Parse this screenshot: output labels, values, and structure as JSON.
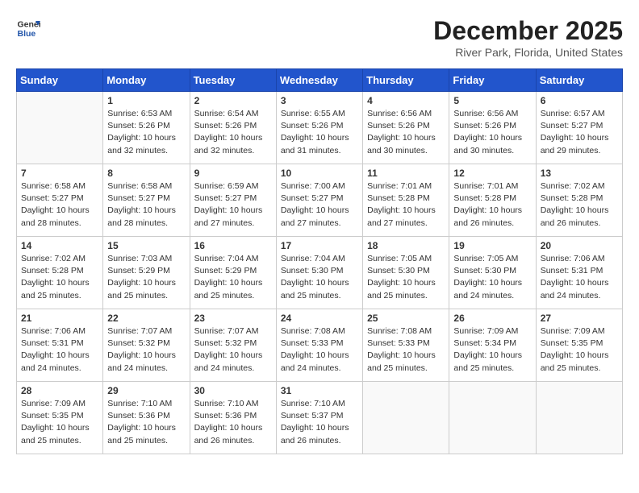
{
  "header": {
    "logo_line1": "General",
    "logo_line2": "Blue",
    "title": "December 2025",
    "subtitle": "River Park, Florida, United States"
  },
  "calendar": {
    "days_of_week": [
      "Sunday",
      "Monday",
      "Tuesday",
      "Wednesday",
      "Thursday",
      "Friday",
      "Saturday"
    ],
    "weeks": [
      [
        {
          "day": "",
          "info": ""
        },
        {
          "day": "1",
          "info": "Sunrise: 6:53 AM\nSunset: 5:26 PM\nDaylight: 10 hours\nand 32 minutes."
        },
        {
          "day": "2",
          "info": "Sunrise: 6:54 AM\nSunset: 5:26 PM\nDaylight: 10 hours\nand 32 minutes."
        },
        {
          "day": "3",
          "info": "Sunrise: 6:55 AM\nSunset: 5:26 PM\nDaylight: 10 hours\nand 31 minutes."
        },
        {
          "day": "4",
          "info": "Sunrise: 6:56 AM\nSunset: 5:26 PM\nDaylight: 10 hours\nand 30 minutes."
        },
        {
          "day": "5",
          "info": "Sunrise: 6:56 AM\nSunset: 5:26 PM\nDaylight: 10 hours\nand 30 minutes."
        },
        {
          "day": "6",
          "info": "Sunrise: 6:57 AM\nSunset: 5:27 PM\nDaylight: 10 hours\nand 29 minutes."
        }
      ],
      [
        {
          "day": "7",
          "info": "Sunrise: 6:58 AM\nSunset: 5:27 PM\nDaylight: 10 hours\nand 28 minutes."
        },
        {
          "day": "8",
          "info": "Sunrise: 6:58 AM\nSunset: 5:27 PM\nDaylight: 10 hours\nand 28 minutes."
        },
        {
          "day": "9",
          "info": "Sunrise: 6:59 AM\nSunset: 5:27 PM\nDaylight: 10 hours\nand 27 minutes."
        },
        {
          "day": "10",
          "info": "Sunrise: 7:00 AM\nSunset: 5:27 PM\nDaylight: 10 hours\nand 27 minutes."
        },
        {
          "day": "11",
          "info": "Sunrise: 7:01 AM\nSunset: 5:28 PM\nDaylight: 10 hours\nand 27 minutes."
        },
        {
          "day": "12",
          "info": "Sunrise: 7:01 AM\nSunset: 5:28 PM\nDaylight: 10 hours\nand 26 minutes."
        },
        {
          "day": "13",
          "info": "Sunrise: 7:02 AM\nSunset: 5:28 PM\nDaylight: 10 hours\nand 26 minutes."
        }
      ],
      [
        {
          "day": "14",
          "info": "Sunrise: 7:02 AM\nSunset: 5:28 PM\nDaylight: 10 hours\nand 25 minutes."
        },
        {
          "day": "15",
          "info": "Sunrise: 7:03 AM\nSunset: 5:29 PM\nDaylight: 10 hours\nand 25 minutes."
        },
        {
          "day": "16",
          "info": "Sunrise: 7:04 AM\nSunset: 5:29 PM\nDaylight: 10 hours\nand 25 minutes."
        },
        {
          "day": "17",
          "info": "Sunrise: 7:04 AM\nSunset: 5:30 PM\nDaylight: 10 hours\nand 25 minutes."
        },
        {
          "day": "18",
          "info": "Sunrise: 7:05 AM\nSunset: 5:30 PM\nDaylight: 10 hours\nand 25 minutes."
        },
        {
          "day": "19",
          "info": "Sunrise: 7:05 AM\nSunset: 5:30 PM\nDaylight: 10 hours\nand 24 minutes."
        },
        {
          "day": "20",
          "info": "Sunrise: 7:06 AM\nSunset: 5:31 PM\nDaylight: 10 hours\nand 24 minutes."
        }
      ],
      [
        {
          "day": "21",
          "info": "Sunrise: 7:06 AM\nSunset: 5:31 PM\nDaylight: 10 hours\nand 24 minutes."
        },
        {
          "day": "22",
          "info": "Sunrise: 7:07 AM\nSunset: 5:32 PM\nDaylight: 10 hours\nand 24 minutes."
        },
        {
          "day": "23",
          "info": "Sunrise: 7:07 AM\nSunset: 5:32 PM\nDaylight: 10 hours\nand 24 minutes."
        },
        {
          "day": "24",
          "info": "Sunrise: 7:08 AM\nSunset: 5:33 PM\nDaylight: 10 hours\nand 24 minutes."
        },
        {
          "day": "25",
          "info": "Sunrise: 7:08 AM\nSunset: 5:33 PM\nDaylight: 10 hours\nand 25 minutes."
        },
        {
          "day": "26",
          "info": "Sunrise: 7:09 AM\nSunset: 5:34 PM\nDaylight: 10 hours\nand 25 minutes."
        },
        {
          "day": "27",
          "info": "Sunrise: 7:09 AM\nSunset: 5:35 PM\nDaylight: 10 hours\nand 25 minutes."
        }
      ],
      [
        {
          "day": "28",
          "info": "Sunrise: 7:09 AM\nSunset: 5:35 PM\nDaylight: 10 hours\nand 25 minutes."
        },
        {
          "day": "29",
          "info": "Sunrise: 7:10 AM\nSunset: 5:36 PM\nDaylight: 10 hours\nand 25 minutes."
        },
        {
          "day": "30",
          "info": "Sunrise: 7:10 AM\nSunset: 5:36 PM\nDaylight: 10 hours\nand 26 minutes."
        },
        {
          "day": "31",
          "info": "Sunrise: 7:10 AM\nSunset: 5:37 PM\nDaylight: 10 hours\nand 26 minutes."
        },
        {
          "day": "",
          "info": ""
        },
        {
          "day": "",
          "info": ""
        },
        {
          "day": "",
          "info": ""
        }
      ]
    ]
  }
}
